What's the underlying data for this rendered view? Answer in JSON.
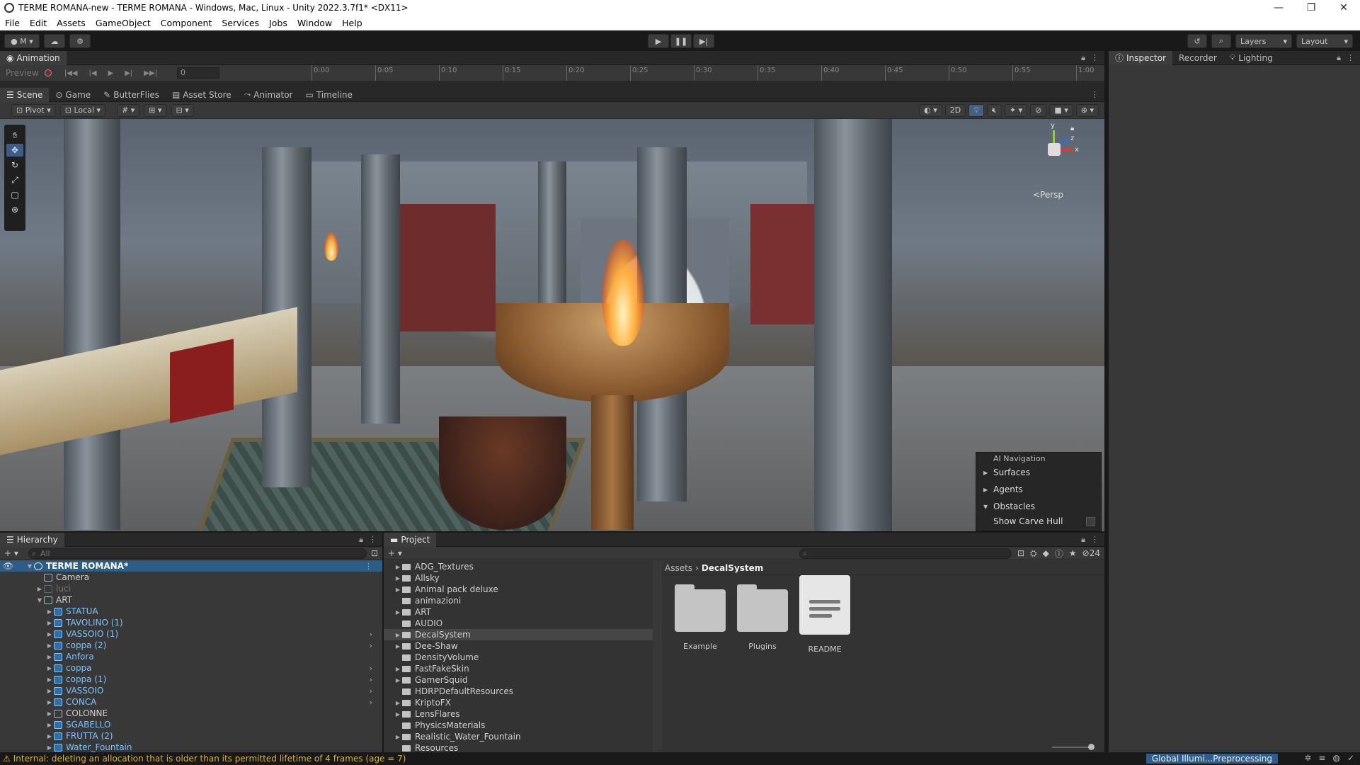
{
  "window": {
    "title": "TERME ROMANA-new - TERME ROMANA - Windows, Mac, Linux - Unity 2022.3.7f1* <DX11>",
    "controls": [
      "—",
      "❐",
      "✕"
    ]
  },
  "menu": [
    "File",
    "Edit",
    "Assets",
    "GameObject",
    "Component",
    "Services",
    "Jobs",
    "Window",
    "Help"
  ],
  "toolbar": {
    "account": "M",
    "layers": "Layers",
    "layout": "Layout"
  },
  "animation": {
    "tab": "Animation",
    "preview": "Preview",
    "frame": "0",
    "ticks": [
      "0:00",
      "0:05",
      "0:10",
      "0:15",
      "0:20",
      "0:25",
      "0:30",
      "0:35",
      "0:40",
      "0:45",
      "0:50",
      "0:55",
      "1:00"
    ]
  },
  "scene_tabs": [
    "Scene",
    "Game",
    "ButterFlies",
    "Asset Store",
    "Animator",
    "Timeline"
  ],
  "scene_toolbar": {
    "pivot": "Pivot",
    "local": "Local",
    "twod": "2D"
  },
  "gizmo": {
    "y": "y",
    "x": "x",
    "z": "z",
    "persp": "<Persp"
  },
  "ai_nav": {
    "title": "AI Navigation",
    "items": [
      "Surfaces",
      "Agents",
      "Obstacles"
    ],
    "show_carve": "Show Carve Hull"
  },
  "inspector_tabs": [
    "Inspector",
    "Recorder",
    "Lighting"
  ],
  "hierarchy": {
    "tab": "Hierarchy",
    "search_placeholder": "All",
    "root": "TERME ROMANA*",
    "items": [
      {
        "name": "Camera",
        "indent": 1,
        "type": "obj",
        "arrow": ""
      },
      {
        "name": "luci",
        "indent": 1,
        "type": "dim",
        "arrow": "▶"
      },
      {
        "name": "ART",
        "indent": 1,
        "type": "obj",
        "arrow": "▼"
      },
      {
        "name": "STATUA",
        "indent": 2,
        "type": "prefab",
        "arrow": "▶",
        "chev": false
      },
      {
        "name": "TAVOLINO (1)",
        "indent": 2,
        "type": "prefab",
        "arrow": "▶",
        "chev": false
      },
      {
        "name": "VASSOIO (1)",
        "indent": 2,
        "type": "prefab",
        "arrow": "▶",
        "chev": true
      },
      {
        "name": "coppa (2)",
        "indent": 2,
        "type": "prefab",
        "arrow": "▶",
        "chev": true
      },
      {
        "name": "Anfora",
        "indent": 2,
        "type": "prefab",
        "arrow": "▶",
        "chev": false
      },
      {
        "name": "coppa",
        "indent": 2,
        "type": "prefab",
        "arrow": "▶",
        "chev": true
      },
      {
        "name": "coppa (1)",
        "indent": 2,
        "type": "prefab",
        "arrow": "▶",
        "chev": true
      },
      {
        "name": "VASSOIO",
        "indent": 2,
        "type": "prefab",
        "arrow": "▶",
        "chev": true
      },
      {
        "name": "CONCA",
        "indent": 2,
        "type": "prefab",
        "arrow": "▶",
        "chev": true
      },
      {
        "name": "COLONNE",
        "indent": 2,
        "type": "obj",
        "arrow": "▶",
        "chev": false
      },
      {
        "name": "SGABELLO",
        "indent": 2,
        "type": "prefab",
        "arrow": "▶",
        "chev": false
      },
      {
        "name": "FRUTTA (2)",
        "indent": 2,
        "type": "prefab",
        "arrow": "▶",
        "chev": false
      },
      {
        "name": "Water_Fountain",
        "indent": 2,
        "type": "prefab",
        "arrow": "▶",
        "chev": false
      }
    ]
  },
  "project": {
    "tab": "Project",
    "count": "24",
    "folders": [
      {
        "name": "ADG_Textures",
        "arrow": "▶"
      },
      {
        "name": "Allsky",
        "arrow": "▶"
      },
      {
        "name": "Animal pack deluxe",
        "arrow": "▶"
      },
      {
        "name": "animazioni",
        "arrow": ""
      },
      {
        "name": "ART",
        "arrow": "▶"
      },
      {
        "name": "AUDIO",
        "arrow": ""
      },
      {
        "name": "DecalSystem",
        "arrow": "▶",
        "selected": true
      },
      {
        "name": "Dee-Shaw",
        "arrow": "▶"
      },
      {
        "name": "DensityVolume",
        "arrow": ""
      },
      {
        "name": "FastFakeSkin",
        "arrow": "▶"
      },
      {
        "name": "GamerSquid",
        "arrow": "▶"
      },
      {
        "name": "HDRPDefaultResources",
        "arrow": ""
      },
      {
        "name": "KriptoFX",
        "arrow": "▶"
      },
      {
        "name": "LensFlares",
        "arrow": "▶"
      },
      {
        "name": "PhysicsMaterials",
        "arrow": ""
      },
      {
        "name": "Realistic_Water_Fountain",
        "arrow": "▶"
      },
      {
        "name": "Resources",
        "arrow": ""
      }
    ],
    "breadcrumb": [
      "Assets",
      "DecalSystem"
    ],
    "assets": [
      {
        "name": "Example",
        "kind": "folder"
      },
      {
        "name": "Plugins",
        "kind": "folder"
      },
      {
        "name": "README",
        "kind": "doc"
      }
    ]
  },
  "status": {
    "message": "Internal: deleting an allocation that is older than its permitted lifetime of 4 frames (age = 7)",
    "gi": "Global Illumi...Preprocessing"
  }
}
